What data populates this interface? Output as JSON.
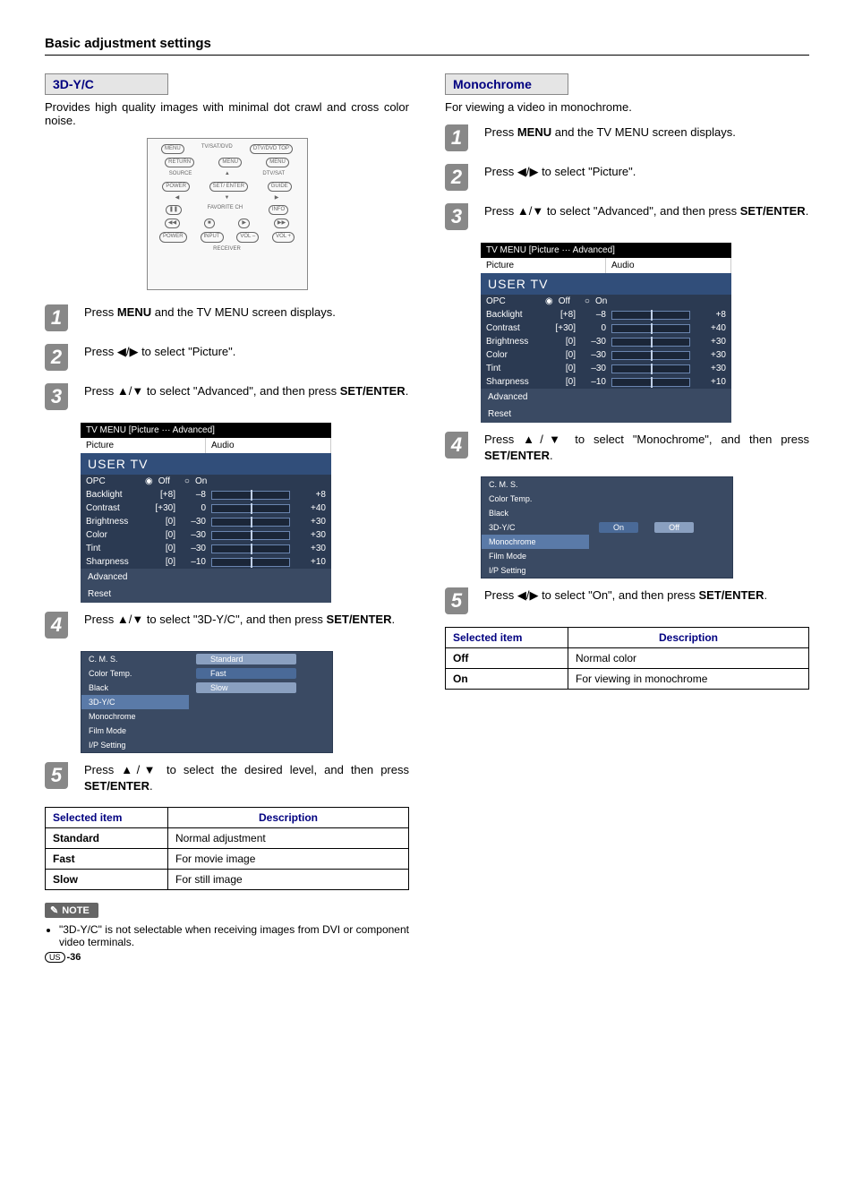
{
  "page_title": "Basic adjustment settings",
  "left": {
    "heading": "3D-Y/C",
    "intro": "Provides high quality images with minimal dot crawl and cross color noise.",
    "remote_labels": [
      "MENU",
      "TV/SAT/DVD",
      "DTV/DVD TOP",
      "RETURN",
      "MENU",
      "MENU",
      "SOURCE",
      "DTV/SAT",
      "POWER",
      "GUIDE",
      "SET/ ENTER",
      "INFO",
      "FAVORITE CH",
      "VCR REC",
      "POWER",
      "INPUT",
      "VOL –",
      "VOL +",
      "RECEIVER"
    ],
    "steps": [
      {
        "num": "1",
        "parts": [
          "Press ",
          "MENU",
          " and the TV MENU screen displays."
        ]
      },
      {
        "num": "2",
        "parts": [
          "Press ",
          "◀/▶",
          " to select \"Picture\"."
        ]
      },
      {
        "num": "3",
        "parts": [
          "Press ",
          "▲/▼",
          " to select \"Advanced\", and then press ",
          "SET/ENTER",
          "."
        ]
      },
      {
        "num": "4",
        "parts": [
          "Press ",
          "▲/▼",
          " to select \"3D-Y/C\", and then press ",
          "SET/ENTER",
          "."
        ]
      },
      {
        "num": "5",
        "parts": [
          "Press ",
          "▲/▼",
          " to select the desired level, and then press ",
          "SET/ENTER",
          "."
        ]
      }
    ],
    "tvmenu": {
      "header": "TV MENU   [Picture ··· Advanced]",
      "tabs": [
        "Picture",
        "Audio"
      ],
      "title": "USER TV",
      "opc": {
        "label": "OPC",
        "off": "Off",
        "on": "On"
      },
      "rows": [
        {
          "label": "Backlight",
          "def": "[+8]",
          "val": "–8",
          "valr": "+8"
        },
        {
          "label": "Contrast",
          "def": "[+30]",
          "val": "0",
          "valr": "+40"
        },
        {
          "label": "Brightness",
          "def": "[0]",
          "val": "–30",
          "valr": "+30"
        },
        {
          "label": "Color",
          "def": "[0]",
          "val": "–30",
          "valr": "+30"
        },
        {
          "label": "Tint",
          "def": "[0]",
          "val": "–30",
          "valr": "+30"
        },
        {
          "label": "Sharpness",
          "def": "[0]",
          "val": "–10",
          "valr": "+10"
        }
      ],
      "footer1": "Advanced",
      "footer2": "Reset"
    },
    "adv": {
      "items": [
        "C. M. S.",
        "Color Temp.",
        "Black",
        "3D-Y/C",
        "Monochrome",
        "Film Mode",
        "I/P Setting"
      ],
      "selected": "3D-Y/C",
      "opts": [
        "Standard",
        "Fast",
        "Slow"
      ],
      "opt_sel": "Fast"
    },
    "table": {
      "h1": "Selected item",
      "h2": "Description",
      "rows": [
        {
          "k": "Standard",
          "v": "Normal adjustment"
        },
        {
          "k": "Fast",
          "v": "For movie image"
        },
        {
          "k": "Slow",
          "v": "For still image"
        }
      ]
    },
    "note_label": "NOTE",
    "note_text": "\"3D-Y/C\" is not selectable when receiving images from DVI or component video terminals.",
    "page_num": "-36",
    "us": "US"
  },
  "right": {
    "heading": "Monochrome",
    "intro": "For viewing a video in monochrome.",
    "steps": [
      {
        "num": "1",
        "parts": [
          "Press ",
          "MENU",
          " and the TV MENU screen displays."
        ]
      },
      {
        "num": "2",
        "parts": [
          "Press ",
          "◀/▶",
          " to select \"Picture\"."
        ]
      },
      {
        "num": "3",
        "parts": [
          "Press ",
          "▲/▼",
          " to select \"Advanced\", and then press ",
          "SET/ENTER",
          "."
        ]
      },
      {
        "num": "4",
        "parts": [
          "Press ",
          "▲/▼",
          " to select \"Monochrome\", and then press ",
          "SET/ENTER",
          "."
        ]
      },
      {
        "num": "5",
        "parts": [
          "Press ",
          "◀/▶",
          " to select \"On\", and then press ",
          "SET/ENTER",
          "."
        ]
      }
    ],
    "adv": {
      "items": [
        "C. M. S.",
        "Color Temp.",
        "Black",
        "3D-Y/C",
        "Monochrome",
        "Film Mode",
        "I/P Setting"
      ],
      "selected": "Monochrome",
      "opts": [
        "On",
        "Off"
      ],
      "opt_sel": "On"
    },
    "table": {
      "h1": "Selected item",
      "h2": "Description",
      "rows": [
        {
          "k": "Off",
          "v": "Normal color"
        },
        {
          "k": "On",
          "v": "For viewing in monochrome"
        }
      ]
    }
  }
}
